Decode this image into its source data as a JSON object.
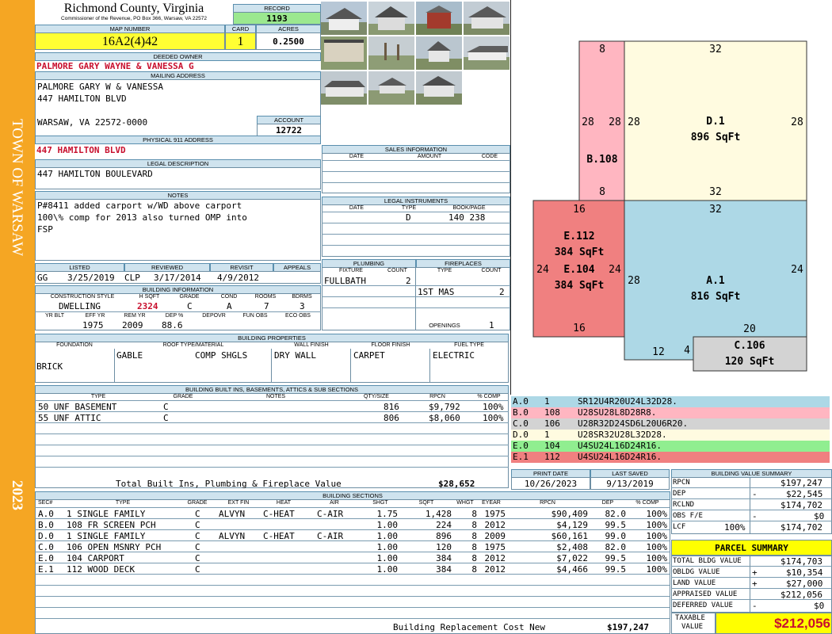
{
  "sidebar": {
    "town": "TOWN OF WARSAW",
    "year": "2023"
  },
  "header": {
    "county": "Richmond County, Virginia",
    "address": "Commissioner of the Revenue, PO Box 366, Warsaw, VA 22572",
    "record_label": "RECORD",
    "record": "1193",
    "map_label": "MAP NUMBER",
    "map": "16A2(4)42",
    "card_label": "CARD",
    "card": "1",
    "acres_label": "ACRES",
    "acres": "0.2500"
  },
  "owner": {
    "deeded_label": "DEEDED OWNER",
    "deeded": "PALMORE GARY WAYNE & VANESSA G",
    "mailing_label": "MAILING ADDRESS",
    "mail1": "PALMORE GARY W & VANESSA",
    "mail2": "447 HAMILTON BLVD",
    "mail3": "WARSAW, VA 22572-0000",
    "account_label": "ACCOUNT",
    "account": "12722",
    "physical_label": "PHYSICAL 911 ADDRESS",
    "physical": "447 HAMILTON BLVD",
    "legal_label": "LEGAL DESCRIPTION",
    "legal": "447 HAMILTON BOULEVARD",
    "notes_label": "NOTES",
    "note1": "P#8411 added carport w/WD above carport",
    "note2": "100\\% comp for 2013 also turned OMP into",
    "note3": "FSP"
  },
  "sales": {
    "label": "SALES INFORMATION",
    "cols": [
      "DATE",
      "AMOUNT",
      "CODE"
    ]
  },
  "legal_instruments": {
    "label": "LEGAL INSTRUMENTS",
    "cols": [
      "DATE",
      "TYPE",
      "BOOK/PAGE"
    ],
    "type": "D",
    "bookpage": "140 238"
  },
  "visits": {
    "listed_label": "LISTED",
    "listed_by": "GG",
    "listed": "3/25/2019",
    "reviewed_label": "REVIEWED",
    "reviewed_by": "CLP",
    "reviewed": "3/17/2014",
    "revisit_label": "REVISIT",
    "revisit": "4/9/2012",
    "appeals_label": "APPEALS"
  },
  "building_info": {
    "label": "BUILDING INFORMATION",
    "cols": [
      "CONSTRUCTION STYLE",
      "H SQFT",
      "GRADE",
      "COND",
      "ROOMS",
      "BDRMS"
    ],
    "style": "DWELLING",
    "hsqft": "2324",
    "grade": "C",
    "cond": "A",
    "rooms": "7",
    "bdrms": "3",
    "cols2": [
      "YR BLT",
      "EFF YR",
      "REM YR",
      "DEP %",
      "DEPOVR",
      "FUN OBS",
      "ECO OBS"
    ],
    "eff_yr": "1975",
    "rem_yr": "2009",
    "dep": "88.6"
  },
  "plumbing": {
    "label": "PLUMBING",
    "cols": [
      "FIXTURE",
      "COUNT"
    ],
    "fixture": "FULLBATH",
    "count": "2"
  },
  "fireplaces": {
    "label": "FIREPLACES",
    "cols": [
      "TYPE",
      "COUNT"
    ],
    "type": "1ST MAS",
    "count": "2",
    "openings_label": "OPENINGS",
    "openings": "1"
  },
  "properties": {
    "label": "BUILDING PROPERTIES",
    "cols": [
      "FOUNDATION",
      "ROOF TYPE/MATERIAL",
      "WALL FINISH",
      "FLOOR FINISH",
      "FUEL TYPE"
    ],
    "foundation": "BRICK",
    "roof_type": "GABLE",
    "roof_material": "COMP SHGLS",
    "wall": "DRY WALL",
    "floor": "CARPET",
    "fuel": "ELECTRIC"
  },
  "builtins": {
    "label": "BUILDING BUILT INS, BASEMENTS, ATTICS & SUB SECTIONS",
    "cols": [
      "TYPE",
      "GRADE",
      "NOTES",
      "QTY/SIZE",
      "RPCN",
      "% COMP"
    ],
    "rows": [
      {
        "type": "50 UNF BASEMENT",
        "grade": "C",
        "qty": "816",
        "rpcn": "$9,792",
        "comp": "100%"
      },
      {
        "type": "55 UNF ATTIC",
        "grade": "C",
        "qty": "806",
        "rpcn": "$8,060",
        "comp": "100%"
      }
    ],
    "total_label": "Total Built Ins, Plumbing & Fireplace Value",
    "total": "$28,652"
  },
  "sketch": {
    "labels": {
      "b_top": "8",
      "b_left": "28",
      "b_right": "28",
      "b_name": "B.108",
      "b_bottom": "8",
      "d_top": "32",
      "d_left": "28",
      "d_right": "28",
      "d_name": "D.1",
      "d_area": "896 SqFt",
      "d_bottom": "32",
      "e_top": "16",
      "e_name": "E.112",
      "e_area": "384 SqFt",
      "e_left": "24",
      "e2_name": "E.104",
      "e_right": "24",
      "e2_area": "384 SqFt",
      "e_bottom": "16",
      "a_top": "32",
      "a_left": "28",
      "a_right": "24",
      "a_name": "A.1",
      "a_area": "816 SqFt",
      "a_bottom": "20",
      "a_step_h": "12",
      "a_step_w": "4",
      "c_name": "C.106",
      "c_area": "120 SqFt"
    }
  },
  "codes": [
    {
      "sec": "A.0",
      "num": "1",
      "code": "SR12U4R20U24L32D28.",
      "color": "#add8e6"
    },
    {
      "sec": "B.0",
      "num": "108",
      "code": "U28SU28L8D28R8.",
      "color": "#ffb6c1"
    },
    {
      "sec": "C.0",
      "num": "106",
      "code": "U28R32D24SD6L20U6R20.",
      "color": "#d3d3d3"
    },
    {
      "sec": "D.0",
      "num": "1",
      "code": "U28SR32U28L32D28.",
      "color": "#fffbe0"
    },
    {
      "sec": "E.0",
      "num": "104",
      "code": "U4SU24L16D24R16.",
      "color": "#90ee90"
    },
    {
      "sec": "E.1",
      "num": "112",
      "code": "U4SU24L16D24R16.",
      "color": "#f08080"
    }
  ],
  "print": {
    "print_label": "PRINT DATE",
    "print_date": "10/26/2023",
    "saved_label": "LAST SAVED",
    "saved": "9/13/2019"
  },
  "sections": {
    "label": "BUILDING SECTIONS",
    "cols": [
      "SEC#",
      "TYPE",
      "GRADE",
      "EXT FIN",
      "HEAT",
      "AIR",
      "SHGT",
      "SQFT",
      "WHGT",
      "EYEAR",
      "RPCN",
      "DEP",
      "% COMP"
    ],
    "rows": [
      {
        "sec": "A.0",
        "type": "1 SINGLE FAMILY",
        "grade": "C",
        "ext": "ALVYN",
        "heat": "C-HEAT",
        "air": "C-AIR",
        "shgt": "1.75",
        "sqft": "1,428",
        "whgt": "8",
        "eyear": "1975",
        "rpcn": "$90,409",
        "dep": "82.0",
        "comp": "100%"
      },
      {
        "sec": "B.0",
        "type": "108 FR SCREEN PCH",
        "grade": "C",
        "ext": "",
        "heat": "",
        "air": "",
        "shgt": "1.00",
        "sqft": "224",
        "whgt": "8",
        "eyear": "2012",
        "rpcn": "$4,129",
        "dep": "99.5",
        "comp": "100%"
      },
      {
        "sec": "D.0",
        "type": "1 SINGLE FAMILY",
        "grade": "C",
        "ext": "ALVYN",
        "heat": "C-HEAT",
        "air": "C-AIR",
        "shgt": "1.00",
        "sqft": "896",
        "whgt": "8",
        "eyear": "2009",
        "rpcn": "$60,161",
        "dep": "99.0",
        "comp": "100%"
      },
      {
        "sec": "C.0",
        "type": "106 OPEN MSNRY PCH",
        "grade": "C",
        "ext": "",
        "heat": "",
        "air": "",
        "shgt": "1.00",
        "sqft": "120",
        "whgt": "8",
        "eyear": "1975",
        "rpcn": "$2,408",
        "dep": "82.0",
        "comp": "100%"
      },
      {
        "sec": "E.0",
        "type": "104 CARPORT",
        "grade": "C",
        "ext": "",
        "heat": "",
        "air": "",
        "shgt": "1.00",
        "sqft": "384",
        "whgt": "8",
        "eyear": "2012",
        "rpcn": "$7,022",
        "dep": "99.5",
        "comp": "100%"
      },
      {
        "sec": "E.1",
        "type": "112 WOOD DECK",
        "grade": "C",
        "ext": "",
        "heat": "",
        "air": "",
        "shgt": "1.00",
        "sqft": "384",
        "whgt": "8",
        "eyear": "2012",
        "rpcn": "$4,466",
        "dep": "99.5",
        "comp": "100%"
      }
    ],
    "replacement_label": "Building Replacement Cost New",
    "replacement": "$197,247"
  },
  "value_summary": {
    "label": "BUILDING VALUE SUMMARY",
    "rpcn_label": "RPCN",
    "rpcn": "$197,247",
    "dep_label": "DEP",
    "dep_sign": "-",
    "dep": "$22,545",
    "rclnd_label": "RCLND",
    "rclnd": "$174,702",
    "obs_label": "OBS F/E",
    "obs_sign": "-",
    "obs": "$0",
    "lcf_label": "LCF",
    "lcf_pct": "100%",
    "lcf": "$174,702"
  },
  "parcel_summary": {
    "label": "PARCEL SUMMARY",
    "total_bldg_label": "TOTAL BLDG VALUE",
    "total_bldg": "$174,703",
    "obldg_label": "OBLDG VALUE",
    "obldg_sign": "+",
    "obldg": "$10,354",
    "land_label": "LAND VALUE",
    "land_sign": "+",
    "land": "$27,000",
    "appraised_label": "APPRAISED VALUE",
    "appraised": "$212,056",
    "deferred_label": "DEFERRED VALUE",
    "deferred_sign": "-",
    "deferred": "$0",
    "taxable_label1": "TAXABLE",
    "taxable_label2": "VALUE",
    "taxable": "$212,056"
  },
  "colors": {
    "sidebar": "#F5A623",
    "header_fill": "#cfe3ee",
    "record": "#9be88f",
    "map": "#ffff33",
    "taxable": "#ffff00",
    "red_text": "#c8102e"
  }
}
